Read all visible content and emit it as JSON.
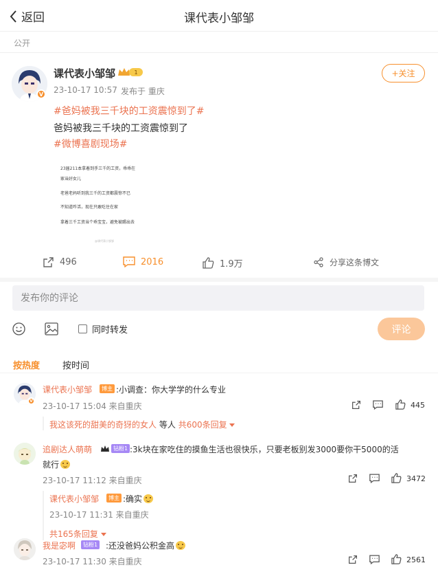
{
  "header": {
    "back_label": "返回",
    "title": "课代表小邹邹"
  },
  "visibility": "公开",
  "post": {
    "author": "课代表小邹邹",
    "crown_level": "1",
    "time": "23-10-17 10:57",
    "location": "发布于 重庆",
    "follow_label": "+关注",
    "topic1": "#爸妈被我三千块的工资震惊到了#",
    "text": "爸妈被我三千块的工资震惊到了",
    "topic2": "#微博喜剧现场#",
    "image_lines": [
      "23届211本拿着到手三千的工资，乖乖在",
      "家当好女儿",
      "老爸老妈听到我三千的工资都震惊不已",
      "不知道咋活，现在只敢吃住在家",
      "拿着三千工资当个乖宝宝，避免被踢出去"
    ],
    "image_watermark": "@课代表小邹邹",
    "actions": {
      "reposts": "496",
      "comments": "2016",
      "likes": "1.9万",
      "share": "分享这条博文"
    }
  },
  "composer": {
    "placeholder": "发布你的评论",
    "repost_label": "同时转发",
    "submit_label": "评论"
  },
  "sort": {
    "hot": "按热度",
    "time": "按时间"
  },
  "comments": [
    {
      "name": "课代表小邹邹",
      "tag": "博主",
      "text": ":小调查：你大学学的什么专业",
      "time": "23-10-17 15:04 来自重庆",
      "likes": "445",
      "replies_a": "我这该死的甜美的奇犽的女人",
      "replies_b": "等人",
      "replies_c": "共600条回复"
    },
    {
      "name": "追剧达人萌萌",
      "tag": "钻粉1",
      "text_line1": ":3k块在家吃住的摸鱼生活也很快乐，只要老板别发3000要你干5000的活",
      "text_line2": "就行",
      "time": "23-10-17 11:12 来自重庆",
      "likes": "3472",
      "reply": {
        "name": "课代表小邹邹",
        "tag": "博主",
        "text": ":确实",
        "time": "23-10-17 11:31 来自重庆"
      },
      "more_replies": "共165条回复"
    },
    {
      "name": "我是宓啊",
      "tag": "钻粉1",
      "text": ":还没爸妈公积金高",
      "time": "23-10-17 11:30 来自重庆",
      "likes": "2561"
    }
  ],
  "colors": {
    "accent": "#f78f2c",
    "link": "#eb7350",
    "submit_disabled": "#fbc79a"
  }
}
